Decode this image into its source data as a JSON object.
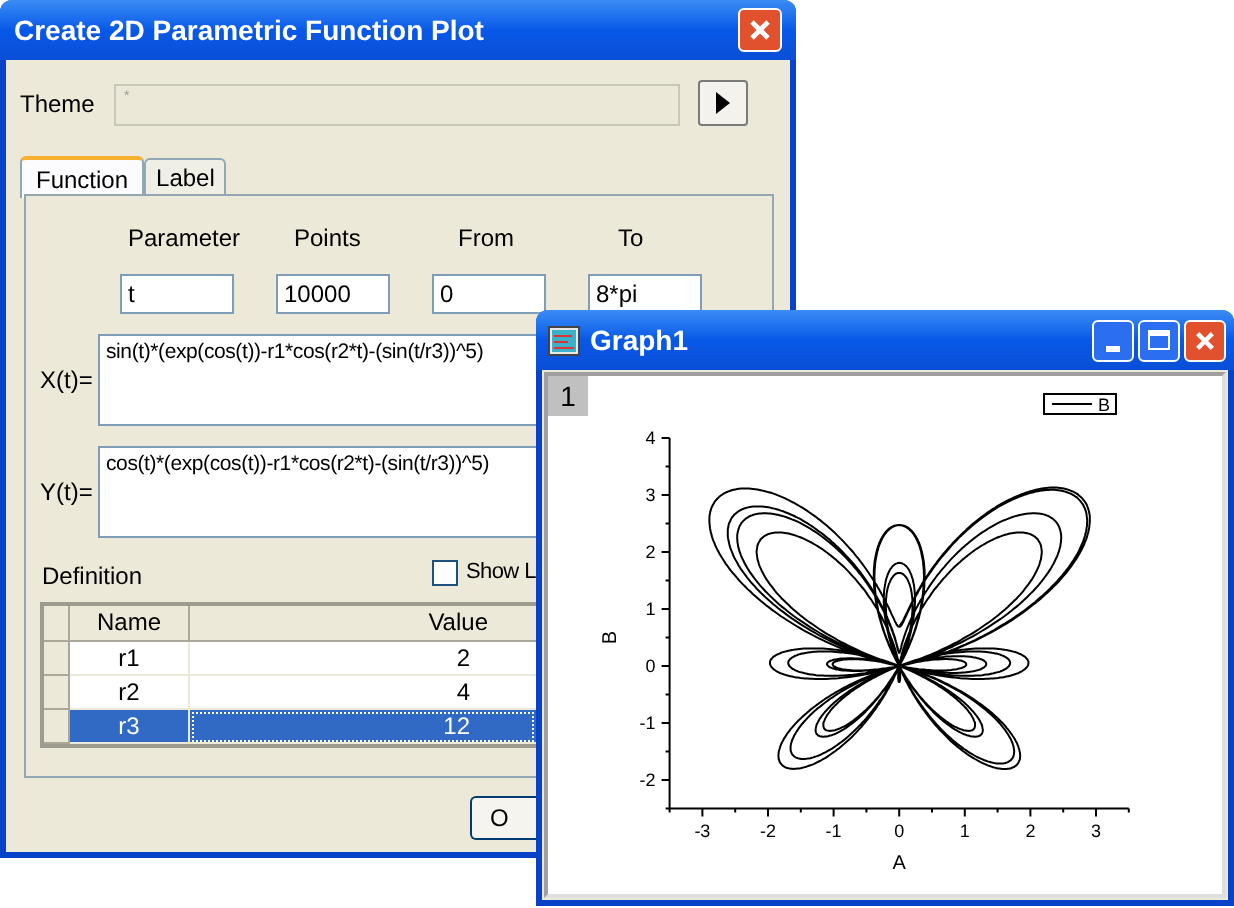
{
  "dialog": {
    "title": "Create 2D Parametric Function Plot",
    "theme": {
      "label": "Theme",
      "placeholder": "*"
    },
    "tabs": [
      {
        "label": "Function",
        "selected": true
      },
      {
        "label": "Label",
        "selected": false
      }
    ],
    "fields": [
      {
        "label": "Parameter",
        "value": "t"
      },
      {
        "label": "Points",
        "value": "10000"
      },
      {
        "label": "From",
        "value": "0"
      },
      {
        "label": "To",
        "value": "8*pi"
      }
    ],
    "expressions": [
      {
        "label": "X(t)=",
        "value": "sin(t)*(exp(cos(t))-r1*cos(r2*t)-(sin(t/r3))^5)"
      },
      {
        "label": "Y(t)=",
        "value": "cos(t)*(exp(cos(t))-r1*cos(r2*t)-(sin(t/r3))^5)"
      }
    ],
    "definition": {
      "label": "Definition"
    },
    "show_checkbox": {
      "label": "Show L",
      "checked": false
    },
    "table": {
      "columns": [
        "Name",
        "Value"
      ],
      "rows": [
        {
          "name": "r1",
          "value": "2",
          "selected": false
        },
        {
          "name": "r2",
          "value": "4",
          "selected": false
        },
        {
          "name": "r3",
          "value": "12",
          "selected": true
        }
      ]
    },
    "button": "O"
  },
  "graph_window": {
    "title": "Graph1",
    "layer": "1",
    "chart_data": {
      "type": "line",
      "xlabel": "A",
      "ylabel": "B",
      "categories": [
        "-3",
        "-2",
        "-1",
        "0",
        "1",
        "2",
        "3"
      ],
      "ylim": [
        -2.5,
        4
      ],
      "yticks": [
        -2,
        -1,
        0,
        1,
        2,
        3,
        4
      ]
    },
    "legend": {
      "label": "B"
    }
  }
}
